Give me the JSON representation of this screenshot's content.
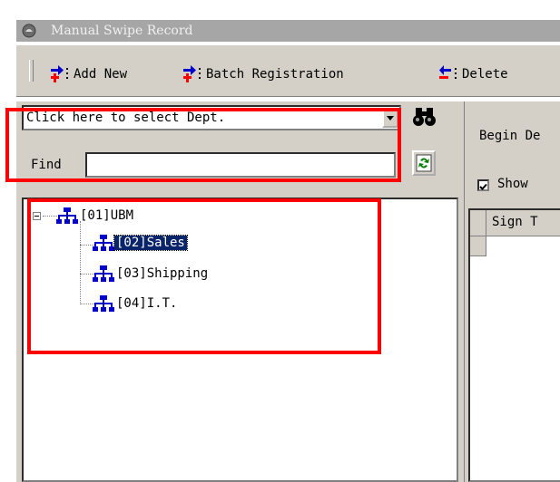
{
  "window": {
    "title": "Manual Swipe Record"
  },
  "toolbar": {
    "add_new_label": "Add New",
    "batch_registration_label": "Batch Registration",
    "delete_label": "Delete"
  },
  "left_panel": {
    "dept_select": {
      "selected": "Click here to select Dept."
    },
    "find": {
      "label": "Find",
      "value": ""
    },
    "tree": {
      "root": {
        "label": "[01]UBM",
        "expanded": true
      },
      "children": [
        {
          "label": "[02]Sales",
          "selected": true
        },
        {
          "label": "[03]Shipping",
          "selected": false
        },
        {
          "label": "[04]I.T.",
          "selected": false
        }
      ]
    }
  },
  "right_panel": {
    "begin_label": "Begin De",
    "show_checkbox": {
      "label": "Show",
      "checked": true
    },
    "grid": {
      "columns": [
        "Sign T"
      ]
    }
  },
  "icons": {
    "add": "add-person-icon",
    "batch": "batch-add-icon",
    "delete": "delete-person-icon",
    "search": "binoculars-icon",
    "refresh": "refresh-icon",
    "org": "org-chart-icon",
    "window": "app-icon"
  },
  "colors": {
    "annotation": "#ff0000",
    "selection": "#0a246a",
    "title_bar": "#a6a6a6"
  }
}
